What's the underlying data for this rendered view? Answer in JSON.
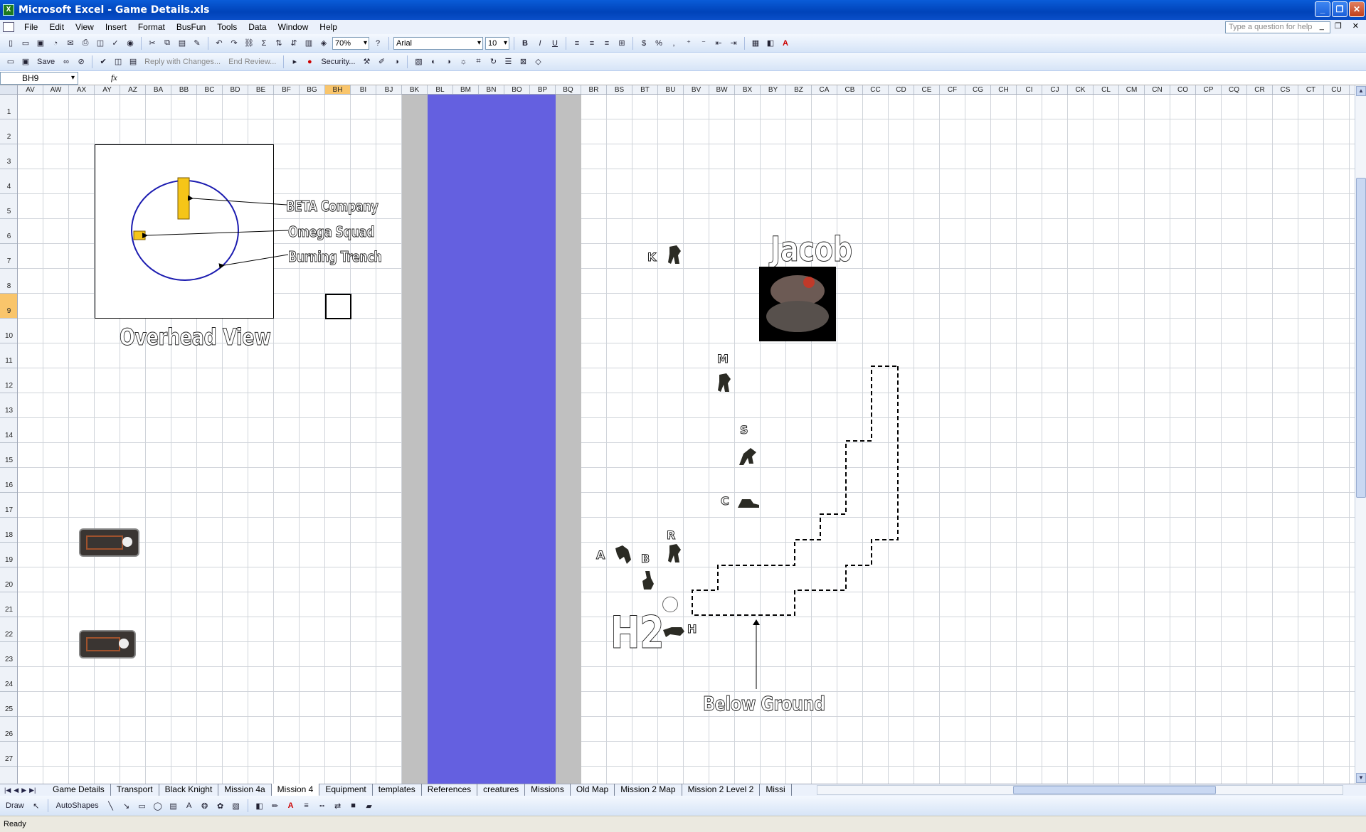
{
  "window": {
    "title": "Microsoft Excel - Game Details.xls"
  },
  "menu": [
    "File",
    "Edit",
    "View",
    "Insert",
    "Format",
    "BusFun",
    "Tools",
    "Data",
    "Window",
    "Help"
  ],
  "help_placeholder": "Type a question for help",
  "toolbar": {
    "zoom": "70%",
    "font": "Arial",
    "font_size": "10",
    "save_label": "Save",
    "reply_label": "Reply with Changes...",
    "end_review_label": "End Review...",
    "security_label": "Security..."
  },
  "formula_bar": {
    "name_box": "BH9",
    "fx": "fx"
  },
  "columns": [
    "AV",
    "AW",
    "AX",
    "AY",
    "AZ",
    "BA",
    "BB",
    "BC",
    "BD",
    "BE",
    "BF",
    "BG",
    "BH",
    "BI",
    "BJ",
    "BK",
    "BL",
    "BM",
    "BN",
    "BO",
    "BP",
    "BQ",
    "BR",
    "BS",
    "BT",
    "BU",
    "BV",
    "BW",
    "BX",
    "BY",
    "BZ",
    "CA",
    "CB",
    "CC",
    "CD",
    "CE",
    "CF",
    "CG",
    "CH",
    "CI",
    "CJ",
    "CK",
    "CL",
    "CM",
    "CN",
    "CO",
    "CP",
    "CQ",
    "CR",
    "CS",
    "CT",
    "CU"
  ],
  "selected_column": "BH",
  "rows": [
    "1",
    "2",
    "3",
    "4",
    "5",
    "6",
    "7",
    "8",
    "9",
    "10",
    "11",
    "12",
    "13",
    "14",
    "15",
    "16",
    "17",
    "18",
    "19",
    "20",
    "21",
    "22",
    "23",
    "24",
    "25",
    "26",
    "27"
  ],
  "selected_row": "9",
  "sheet": {
    "overhead_title": "Overhead View",
    "callouts": [
      "BETA Company",
      "Omega Squad",
      "Burning Trench"
    ],
    "jacob_label": "Jacob",
    "unit_letters": {
      "k": "K",
      "m": "M",
      "s": "S",
      "c": "C",
      "r": "R",
      "a": "A",
      "b": "B",
      "h": "H"
    },
    "h2_label": "H2",
    "below_ground": "Below Ground"
  },
  "sheet_tabs": [
    "Game Details",
    "Transport",
    "Black Knight",
    "Mission 4a",
    "Mission 4",
    "Equipment",
    "templates",
    "References",
    "creatures",
    "Missions",
    "Old Map",
    "Mission 2 Map",
    "Mission 2 Level 2",
    "Missi"
  ],
  "active_tab": "Mission 4",
  "draw_toolbar": {
    "draw_label": "Draw",
    "autoshapes_label": "AutoShapes"
  },
  "status": "Ready",
  "colors": {
    "band_gray": "#c0c0c0",
    "band_blue": "#6460e0",
    "highlight": "#f9c56b",
    "circle": "#1c1cb0",
    "marker": "#f5c518"
  }
}
